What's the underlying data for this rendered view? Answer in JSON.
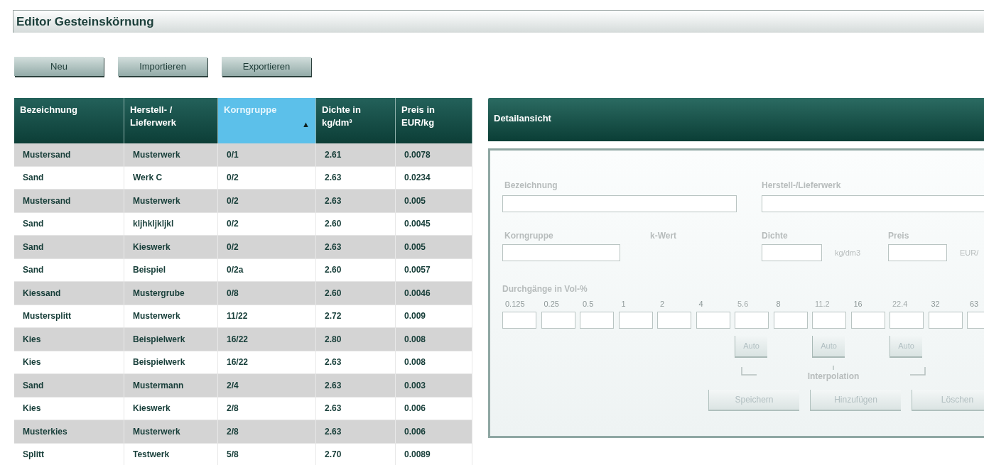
{
  "window": {
    "title": "Editor Gesteinskörnung"
  },
  "toolbar": [
    {
      "label": "Neu"
    },
    {
      "label": "Importieren"
    },
    {
      "label": "Exportieren"
    }
  ],
  "table": {
    "columns": [
      {
        "label": "Bezeichnung",
        "selected": false
      },
      {
        "label": "Herstell- / Lieferwerk",
        "selected": false
      },
      {
        "label": "Korngruppe",
        "selected": true,
        "sort_indicator": "▲"
      },
      {
        "label": "Dichte in kg/dm³",
        "selected": false
      },
      {
        "label": "Preis in EUR/kg",
        "selected": false
      }
    ],
    "rows": [
      [
        "Mustersand",
        "Musterwerk",
        "0/1",
        "2.61",
        "0.0078"
      ],
      [
        "Sand",
        "Werk C",
        "0/2",
        "2.63",
        "0.0234"
      ],
      [
        "Mustersand",
        "Musterwerk",
        "0/2",
        "2.63",
        "0.005"
      ],
      [
        "Sand",
        "kljhkljkljkl",
        "0/2",
        "2.60",
        "0.0045"
      ],
      [
        "Sand",
        "Kieswerk",
        "0/2",
        "2.63",
        "0.005"
      ],
      [
        "Sand",
        "Beispiel",
        "0/2a",
        "2.60",
        "0.0057"
      ],
      [
        "Kiessand",
        "Mustergrube",
        "0/8",
        "2.60",
        "0.0046"
      ],
      [
        "Mustersplitt",
        "Musterwerk",
        "11/22",
        "2.72",
        "0.009"
      ],
      [
        "Kies",
        "Beispielwerk",
        "16/22",
        "2.80",
        "0.008"
      ],
      [
        "Kies",
        "Beispielwerk",
        "16/22",
        "2.63",
        "0.008"
      ],
      [
        "Sand",
        "Mustermann",
        "2/4",
        "2.63",
        "0.003"
      ],
      [
        "Kies",
        "Kieswerk",
        "2/8",
        "2.63",
        "0.006"
      ],
      [
        "Musterkies",
        "Musterwerk",
        "2/8",
        "2.63",
        "0.006"
      ],
      [
        "Splitt",
        "Testwerk",
        "5/8",
        "2.70",
        "0.0089"
      ]
    ]
  },
  "detail": {
    "title": "Detailansicht",
    "disabled": true,
    "bezeichnung_label": "Bezeichnung",
    "werk_label": "Herstell-/Lieferwerk",
    "korngruppe_label": "Korngruppe",
    "kwert_label": "k-Wert",
    "dichte_label": "Dichte",
    "dichte_unit": "kg/dm3",
    "preis_label": "Preis",
    "preis_unit": "EUR/",
    "sieves_label": "Durchgänge in Vol-%",
    "sieves": [
      {
        "label": "0.125",
        "auto": false
      },
      {
        "label": "0.25",
        "auto": false
      },
      {
        "label": "0.5",
        "auto": false
      },
      {
        "label": "1",
        "auto": false
      },
      {
        "label": "2",
        "auto": false
      },
      {
        "label": "4",
        "auto": false
      },
      {
        "label": "5.6",
        "auto": true,
        "auto_label": "Auto"
      },
      {
        "label": "8",
        "auto": false
      },
      {
        "label": "11.2",
        "auto": true,
        "auto_label": "Auto"
      },
      {
        "label": "16",
        "auto": false
      },
      {
        "label": "22.4",
        "auto": true,
        "auto_label": "Auto"
      },
      {
        "label": "32",
        "auto": false
      },
      {
        "label": "63",
        "auto": false
      }
    ],
    "interpolation_label": "Interpolation",
    "buttons": [
      {
        "label": "Speichern",
        "disabled": true
      },
      {
        "label": "Hinzufügen",
        "disabled": true
      },
      {
        "label": "Löschen",
        "disabled": true
      }
    ]
  }
}
